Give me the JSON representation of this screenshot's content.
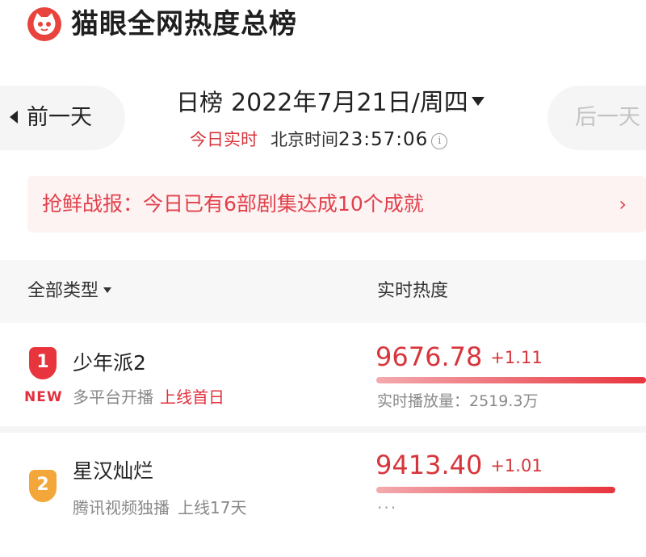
{
  "header": {
    "logo_icon": "maoyan-cat-logo-icon",
    "title": "猫眼全网热度总榜"
  },
  "nav": {
    "prev_label": "前一天",
    "next_label": "后一天",
    "ranking_type": "日榜",
    "date": "2022年7月21日/周四",
    "realtime_label": "今日实时",
    "beijing_label": "北京时间",
    "beijing_time": "23:57:06",
    "info_icon": "i"
  },
  "notice": {
    "text": "抢鲜战报：今日已有6部剧集达成10个成就",
    "chevron": "›"
  },
  "list_header": {
    "filter_label": "全部类型",
    "column_title": "实时热度"
  },
  "rows": [
    {
      "rank": "1",
      "new_tag": "NEW",
      "name": "少年派2",
      "platform": "多平台开播",
      "status": "上线首日",
      "score": "9676.78",
      "delta": "+1.11",
      "heat_fraction": 1.0,
      "plays": "实时播放量：2519.3万"
    },
    {
      "rank": "2",
      "name": "星汉灿烂",
      "platform": "腾讯视频独播",
      "status": "上线17天",
      "score": "9413.40",
      "delta": "+1.01",
      "heat_fraction": 0.97,
      "plays_placeholder": "···"
    }
  ],
  "colors": {
    "accent_red": "#d6363b",
    "rank1": "#e8343d",
    "rank2": "#f3a73a",
    "notice_bg": "#fdf3f3"
  }
}
